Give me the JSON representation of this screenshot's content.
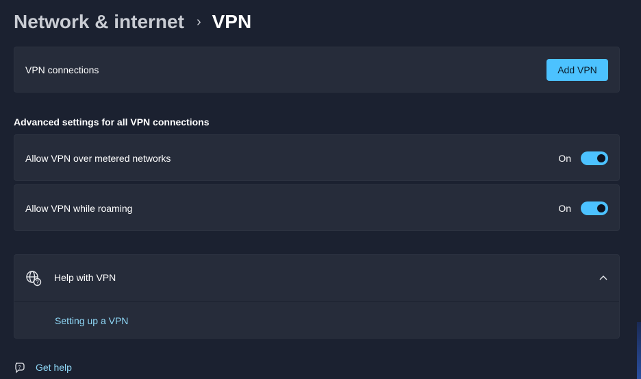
{
  "breadcrumb": {
    "parent": "Network & internet",
    "separator": "›",
    "current": "VPN"
  },
  "vpn_connections": {
    "label": "VPN connections",
    "add_button_label": "Add VPN"
  },
  "advanced": {
    "title": "Advanced settings for all VPN connections",
    "settings": [
      {
        "label": "Allow VPN over metered networks",
        "state_label": "On",
        "on": true
      },
      {
        "label": "Allow VPN while roaming",
        "state_label": "On",
        "on": true
      }
    ]
  },
  "help": {
    "title": "Help with VPN",
    "icon": "globe-help-icon",
    "expanded": true,
    "links": [
      "Setting up a VPN"
    ]
  },
  "get_help": {
    "label": "Get help",
    "icon": "chat-help-icon"
  },
  "colors": {
    "accent": "#4cc2ff",
    "link": "#8fd8f7",
    "background": "#1b2130",
    "card": "#262c3a"
  }
}
